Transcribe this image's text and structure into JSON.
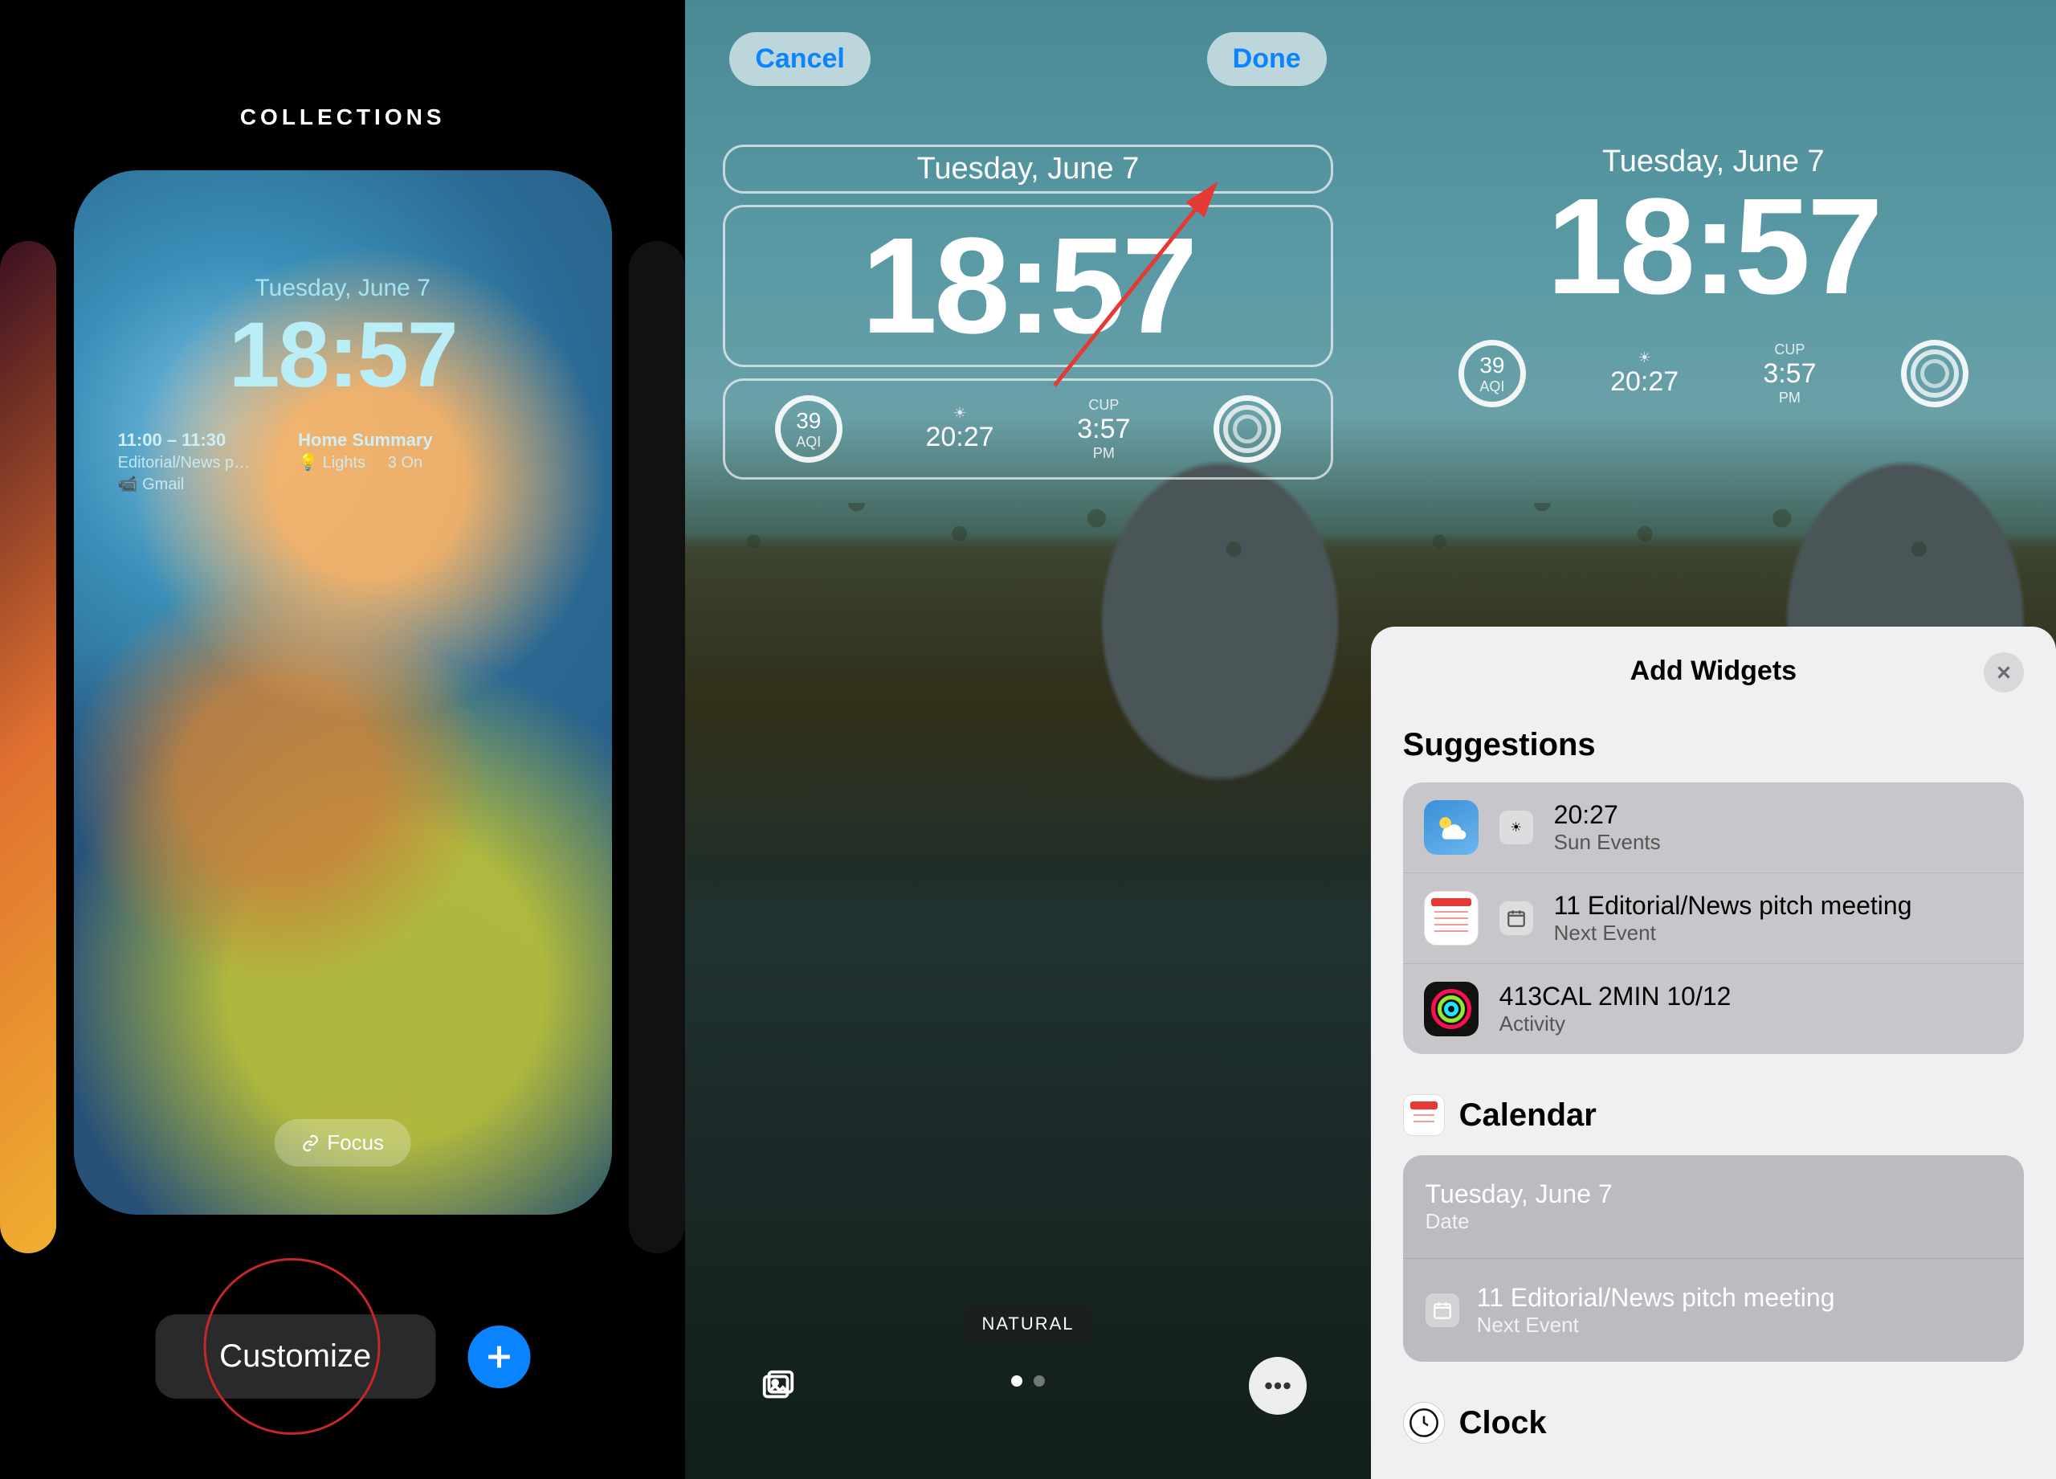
{
  "panel1": {
    "header": "COLLECTIONS",
    "date": "Tuesday, June 7",
    "time": "18:57",
    "widget_left": {
      "line1": "11:00 – 11:30",
      "line2": "Editorial/News p…",
      "line3": "Gmail"
    },
    "widget_right": {
      "title": "Home Summary",
      "l1": "Lights",
      "l2": "3 On"
    },
    "focus_label": "Focus",
    "customize_label": "Customize"
  },
  "panel2": {
    "cancel": "Cancel",
    "done": "Done",
    "date": "Tuesday, June 7",
    "time": "18:57",
    "widgets": {
      "aqi": {
        "value": "39",
        "label": "AQI"
      },
      "sun": {
        "value": "20:27"
      },
      "location": {
        "top": "CUP",
        "time": "3:57",
        "ampm": "PM"
      }
    },
    "filter_label": "NATURAL"
  },
  "panel3": {
    "date": "Tuesday, June 7",
    "time": "18:57",
    "widgets": {
      "aqi": {
        "value": "39",
        "label": "AQI"
      },
      "sun": {
        "value": "20:27"
      },
      "location": {
        "top": "CUP",
        "time": "3:57",
        "ampm": "PM"
      }
    },
    "sheet": {
      "title": "Add Widgets",
      "suggestions_label": "Suggestions",
      "suggestions": [
        {
          "icon": "weather",
          "title": "20:27",
          "subtitle": "Sun Events",
          "prefix": "sunrise"
        },
        {
          "icon": "calendar",
          "title": "11 Editorial/News pitch meeting",
          "subtitle": "Next Event",
          "prefix": "cal-small"
        },
        {
          "icon": "fitness",
          "title": "413CAL 2MIN 10/12",
          "subtitle": "Activity",
          "prefix": "rings"
        }
      ],
      "calendar_label": "Calendar",
      "calendar_items": [
        {
          "title": "Tuesday, June 7",
          "subtitle": "Date"
        },
        {
          "title": "11 Editorial/News pitch meeting",
          "subtitle": "Next Event",
          "prefix": "cal-small"
        }
      ],
      "clock_label": "Clock"
    }
  }
}
